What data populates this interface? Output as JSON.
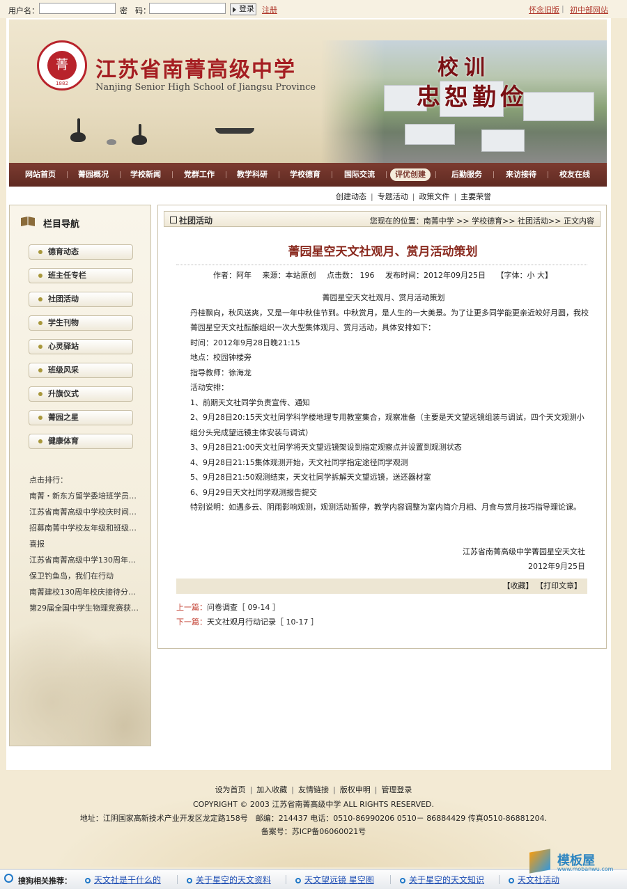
{
  "topbar": {
    "username_label": "用户名：",
    "password_label": "密　码：",
    "username_value": "",
    "password_value": "",
    "login_label": "登录",
    "register_label": "注册",
    "old_site_label": "怀念旧版",
    "junior_site_label": "初中部网站",
    "separator": "|"
  },
  "banner": {
    "logo_char": "菁",
    "logo_year": "1882",
    "school_name_cn": "江苏省南菁高级中学",
    "school_name_en": "Nanjing Senior High School of Jiangsu Province",
    "motto_title": "校训",
    "motto": "忠恕勤俭"
  },
  "nav": {
    "items": [
      {
        "label": "网站首页"
      },
      {
        "label": "菁园概况"
      },
      {
        "label": "学校新闻"
      },
      {
        "label": "党群工作"
      },
      {
        "label": "教学科研"
      },
      {
        "label": "学校德育"
      },
      {
        "label": "国际交流"
      },
      {
        "label": "评优创建"
      },
      {
        "label": "后勤服务"
      },
      {
        "label": "来访接待"
      },
      {
        "label": "校友在线"
      }
    ],
    "active_index": 7
  },
  "subnav": {
    "items": [
      "创建动态",
      "专题活动",
      "政策文件",
      "主要荣誉"
    ],
    "separator": "|"
  },
  "sidebar": {
    "title": "栏目导航",
    "items": [
      "德育动态",
      "班主任专栏",
      "社团活动",
      "学生刊物",
      "心灵驿站",
      "班级风采",
      "升旗仪式",
      "菁园之星",
      "健康体育"
    ],
    "hot_title": "点击排行：",
    "hot_items": [
      "南菁・新东方留学委培班学员…",
      "江苏省南菁高级中学校庆时间…",
      "招募南菁中学校友年级和班级…",
      "喜报",
      "江苏省南菁高级中学130周年…",
      "保卫钓鱼岛，我们在行动",
      "南菁建校130周年校庆接待分…",
      "第29届全国中学生物理竞赛获…"
    ]
  },
  "main": {
    "section_title": "社团活动",
    "breadcrumb": "您现在的位置：南菁中学 >> 学校德育>> 社团活动>> 正文内容",
    "article": {
      "title": "菁园星空天文社观月、赏月活动策划",
      "author": "作者：阿年",
      "source": "来源：本站原创",
      "hits": "点击数：  196",
      "published": "发布时间：2012年09月25日",
      "font_size": "【字体：小 大】",
      "paragraphs": [
        {
          "text": "菁园星空天文社观月、赏月活动策划",
          "style": "c"
        },
        {
          "text": "丹桂飘向，秋风送爽，又是一年中秋佳节到。中秋赏月，是人生的一大美景。为了让更多同学能更亲近皎好月圆，我校菁园星空天文社酝酿组织一次大型集体观月、赏月活动，具体安排如下：",
          "style": "ind"
        },
        {
          "text": "时间：2012年9月28日晚21:15",
          "style": "ind"
        },
        {
          "text": "地点：校园钟楼旁",
          "style": "ind"
        },
        {
          "text": "指导教师：徐海龙",
          "style": "ind"
        },
        {
          "text": "活动安排：",
          "style": "ind"
        },
        {
          "text": "1、前期天文社同学负责宣传、通知",
          "style": "ind"
        },
        {
          "text": "2、9月28日20:15天文社同学科学楼地理专用教室集合，观察准备（主要是天文望远镜组装与调试，四个天文观测小组分头完成望远镜主体安装与调试）",
          "style": "ind"
        },
        {
          "text": "3、9月28日21:00天文社同学将天文望远镜架设到指定观察点并设置到观测状态",
          "style": "ind"
        },
        {
          "text": "4、9月28日21:15集体观测开始，天文社同学指定途径同学观测",
          "style": "ind"
        },
        {
          "text": "5、9月28日21:50观测结束，天文社同学拆解天文望远镜，送还器材室",
          "style": "ind"
        },
        {
          "text": "6、9月29日天文社同学观测报告提交",
          "style": "ind"
        },
        {
          "text": "特别说明：如遇多云、阴雨影响观测，观测活动暂停，教学内容调整为室内简介月相、月食与赏月技巧指导理论课。",
          "style": "ind"
        }
      ],
      "sign_org": "江苏省南菁高级中学菁园星空天文社",
      "sign_date": "2012年9月25日",
      "tools": "【收藏】 【打印文章】",
      "prev_label": "上一篇：",
      "prev_title": "问卷调查［ 09-14 ］",
      "next_label": "下一篇：",
      "next_title": "天文社观月行动记录［ 10-17 ］"
    }
  },
  "footer": {
    "links": [
      "设为首页",
      "加入收藏",
      "友情链接",
      "版权申明",
      "管理登录"
    ],
    "separator": "|",
    "copyright": "COPYRIGHT © 2003 江苏省南菁高级中学  ALL RIGHTS RESERVED.",
    "address": "地址：江阴国家高新技术产业开发区龙定路158号　邮编：214437 电话：0510-86990206 0510－ 86884429 传真0510-86881204.",
    "icp": "备案号：苏ICP备06060021号"
  },
  "sogou": {
    "label": "搜狗相关推荐：",
    "items": [
      "天文社是干什么的",
      "关于星空的天文资料",
      "天文望远镜 星空图",
      "关于星空的天文知识",
      "天文社活动"
    ]
  },
  "watermark": {
    "text": "模板屋",
    "url": "www.mobanwu.com"
  },
  "colors": {
    "nav_bg": "#6e3329",
    "accent_red": "#a51e22",
    "title_red": "#8a2a1f",
    "link_blue": "#1f4fb4"
  }
}
